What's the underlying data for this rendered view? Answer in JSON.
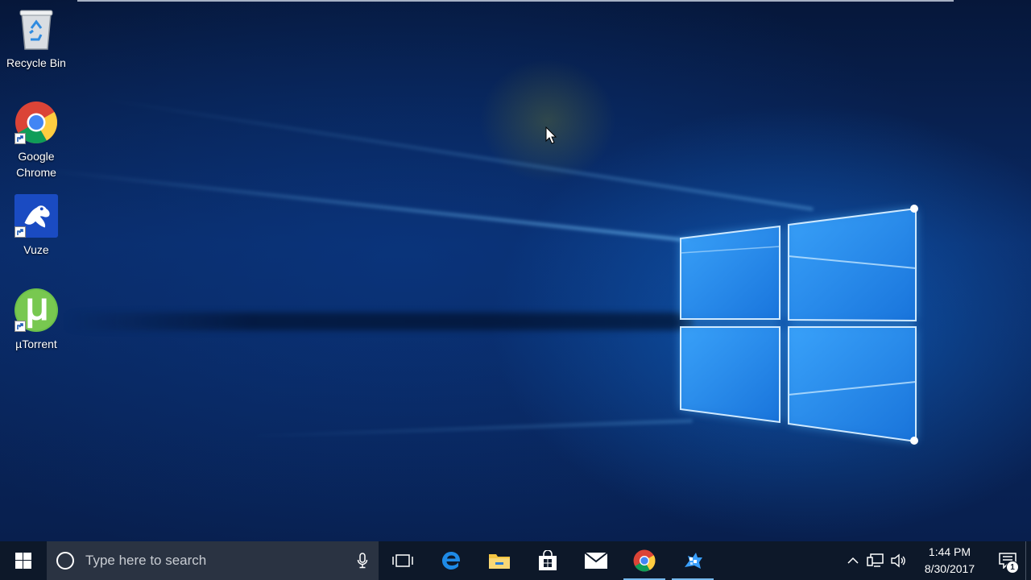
{
  "desktop": {
    "icons": [
      {
        "label": "Recycle Bin",
        "icon": "recycle-bin-icon"
      },
      {
        "label": "Google\nChrome",
        "icon": "chrome-icon"
      },
      {
        "label": "Vuze",
        "icon": "vuze-icon"
      },
      {
        "label": "µTorrent",
        "icon": "utorrent-icon"
      }
    ]
  },
  "taskbar": {
    "search": {
      "placeholder": "Type here to search"
    },
    "pinned": [
      {
        "name": "task-view",
        "icon": "task-view-icon"
      },
      {
        "name": "edge",
        "icon": "edge-icon"
      },
      {
        "name": "file-explorer",
        "icon": "folder-icon"
      },
      {
        "name": "store",
        "icon": "store-icon"
      },
      {
        "name": "mail",
        "icon": "mail-icon"
      },
      {
        "name": "chrome",
        "icon": "chrome-icon",
        "active": true
      },
      {
        "name": "vuze",
        "icon": "vuze-icon",
        "active": true
      }
    ],
    "tray": {
      "time": "1:44 PM",
      "date": "8/30/2017",
      "notification_count": "1"
    }
  },
  "colors": {
    "taskbar_bg": "#0d1829",
    "search_bg": "#2a3342",
    "accent": "#76b9ed"
  }
}
